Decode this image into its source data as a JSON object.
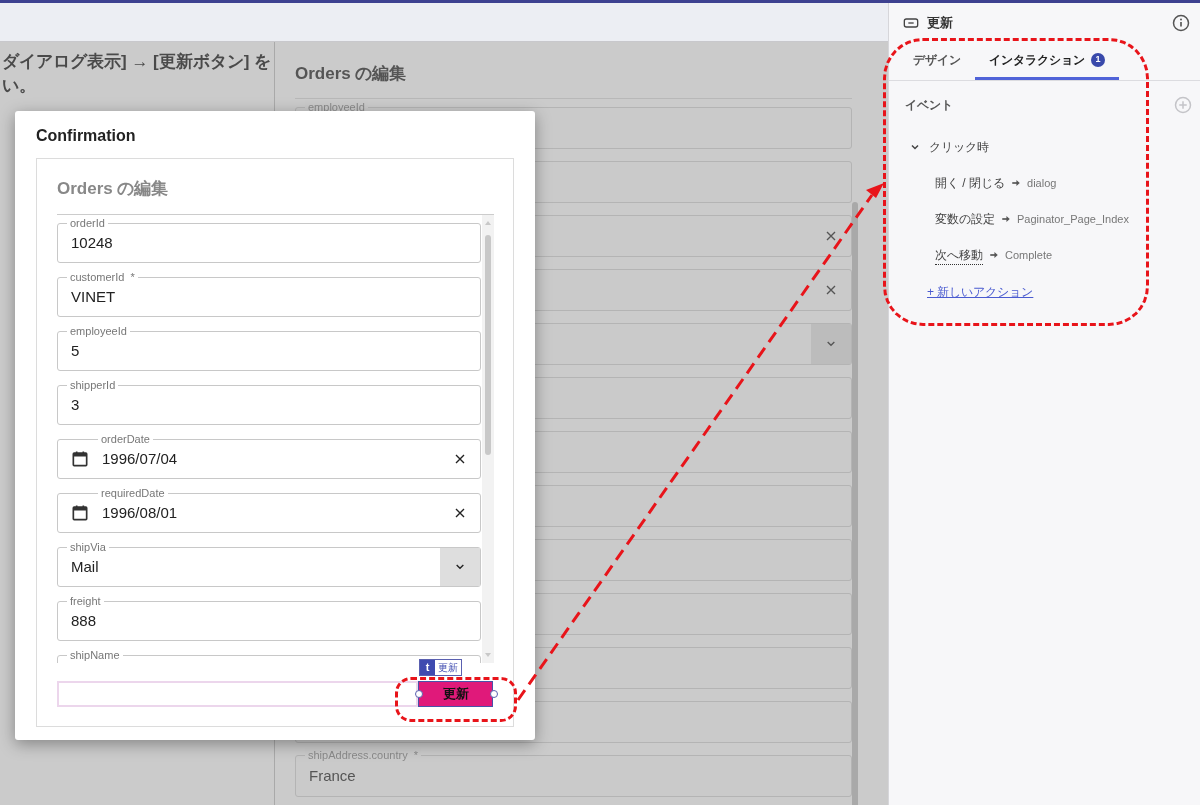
{
  "canvas_note": {
    "lines": [
      "ダイアログ表示] → [更新ボタン] を",
      "い。"
    ]
  },
  "background_form": {
    "title": "Orders の編集",
    "fields": [
      {
        "kind": "text",
        "label": "employeeId"
      },
      {
        "kind": "text"
      },
      {
        "kind": "date"
      },
      {
        "kind": "date"
      },
      {
        "kind": "select"
      },
      {
        "kind": "text"
      },
      {
        "kind": "text"
      },
      {
        "kind": "text"
      },
      {
        "kind": "text"
      },
      {
        "kind": "text"
      },
      {
        "kind": "text"
      },
      {
        "kind": "text"
      },
      {
        "kind": "text",
        "label": "shipAddress.country  *",
        "value": "France"
      }
    ]
  },
  "dialog": {
    "title": "Confirmation",
    "form_title": "Orders の編集",
    "fields": [
      {
        "kind": "text",
        "label": "orderId",
        "value": "10248"
      },
      {
        "kind": "text",
        "label": "customerId  *",
        "value": "VINET"
      },
      {
        "kind": "text",
        "label": "employeeId",
        "value": "5"
      },
      {
        "kind": "text",
        "label": "shipperId",
        "value": "3"
      },
      {
        "kind": "date",
        "label": "orderDate",
        "value": "1996/07/04"
      },
      {
        "kind": "date",
        "label": "requiredDate",
        "value": "1996/08/01"
      },
      {
        "kind": "select",
        "label": "shipVia",
        "value": "Mail"
      },
      {
        "kind": "text",
        "label": "freight",
        "value": "888"
      },
      {
        "kind": "text",
        "label": "shipName"
      }
    ],
    "selection_tag": {
      "icon": "t",
      "label": "更新"
    },
    "submit_button": "更新"
  },
  "panel": {
    "component": "更新",
    "tabs": [
      {
        "label": "デザイン",
        "selected": false
      },
      {
        "label": "インタラクション",
        "selected": true,
        "badge": "1"
      }
    ],
    "section": "イベント",
    "events": [
      {
        "label": "クリック時",
        "expanded": true,
        "actions": [
          {
            "action": "開く / 閉じる",
            "target": "dialog",
            "dotted_underline": false
          },
          {
            "action": "変数の設定",
            "target": "Paginator_Page_Index",
            "dotted_underline": false
          },
          {
            "action": "次へ移動",
            "target": "Complete",
            "dotted_underline": true
          }
        ]
      }
    ],
    "add_action_link": "+ 新しいアクション"
  }
}
